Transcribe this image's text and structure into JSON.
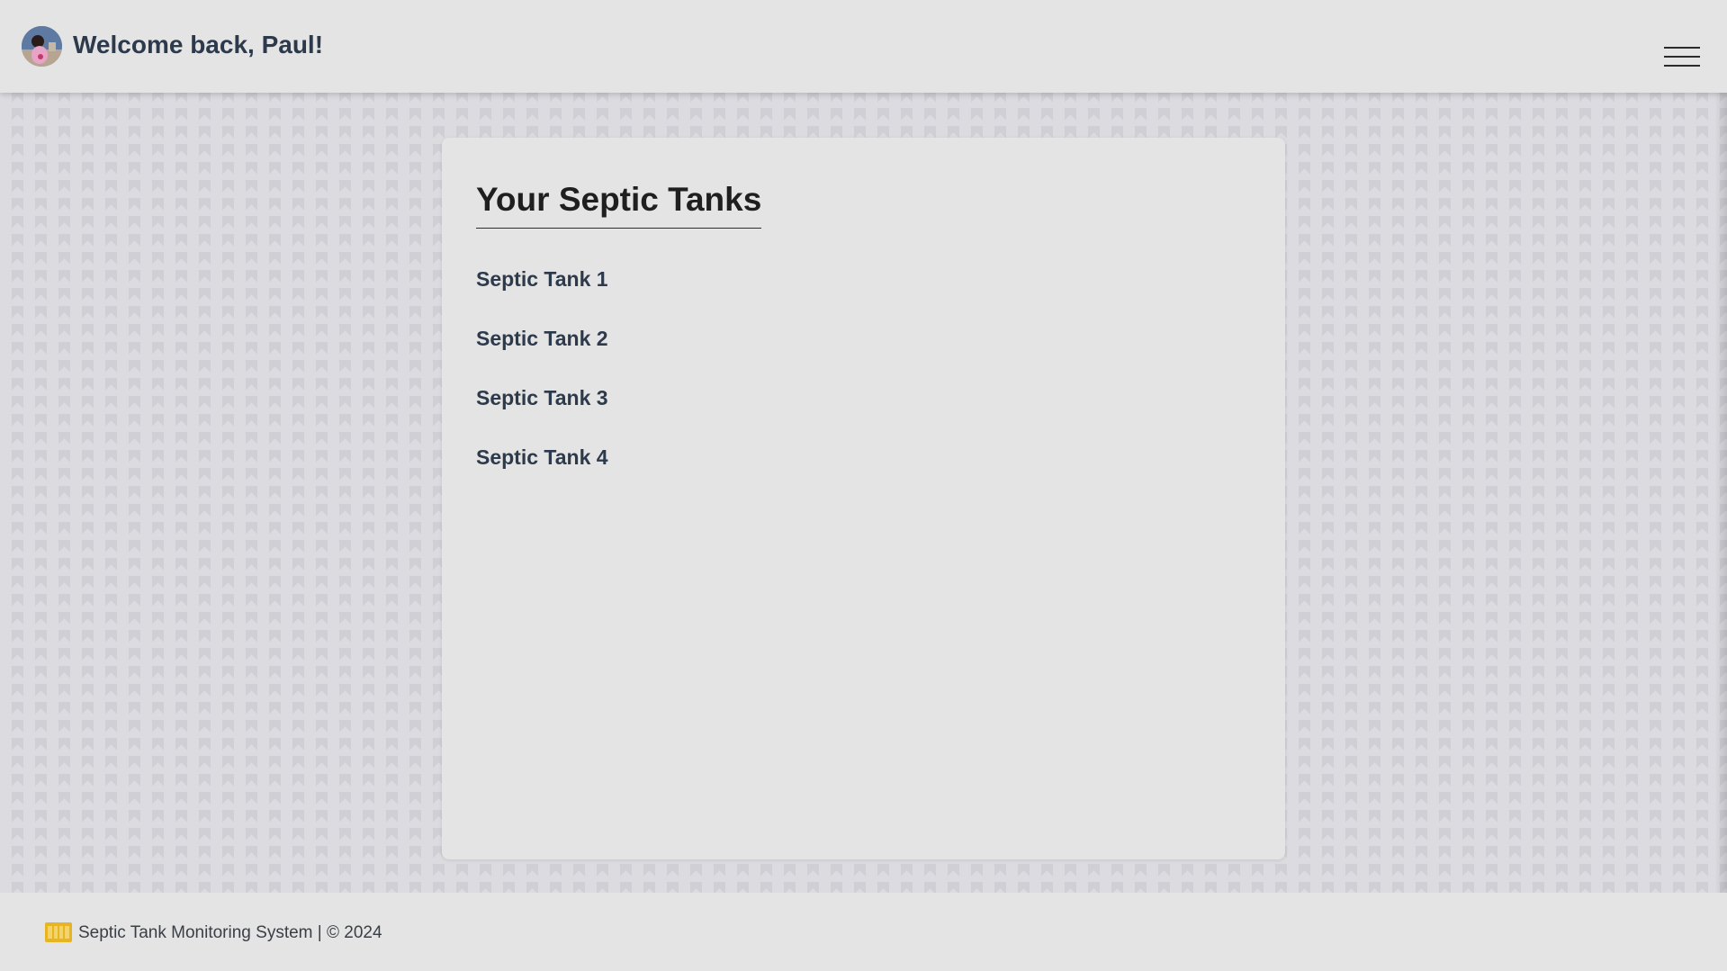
{
  "header": {
    "welcome_text": "Welcome back, Paul!",
    "avatar_icon": "user-avatar-photo",
    "menu_icon": "hamburger-menu-icon"
  },
  "main": {
    "title": "Your Septic Tanks",
    "tanks": [
      {
        "label": "Septic Tank 1"
      },
      {
        "label": "Septic Tank 2"
      },
      {
        "label": "Septic Tank 3"
      },
      {
        "label": "Septic Tank 4"
      }
    ]
  },
  "footer": {
    "logo_icon": "stms-logo-icon",
    "text": "Septic Tank Monitoring System | © 2024"
  },
  "colors": {
    "page_background": "#dcdce0",
    "panel_background": "#e4e4e4",
    "heading_text": "#1f1f1f",
    "primary_text": "#2d3a4c",
    "logo_accent": "#e7b521"
  }
}
